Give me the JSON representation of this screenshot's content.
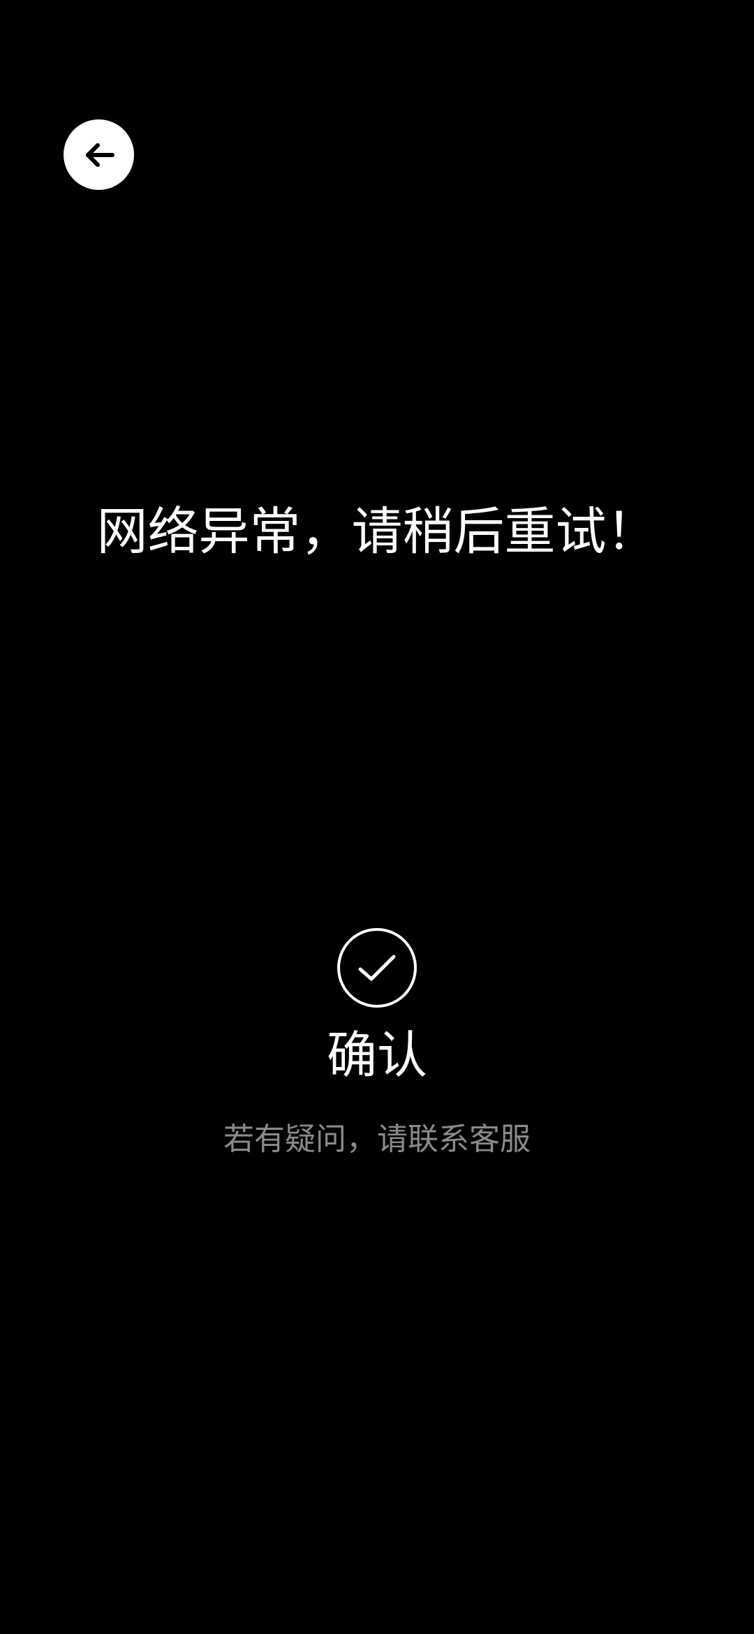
{
  "screen": {
    "background": "#000000"
  },
  "back_button": {
    "icon": "arrow-left-icon",
    "color": "#ffffff"
  },
  "message": {
    "text": "网络异常，请稍后重试！"
  },
  "confirm": {
    "icon": "check-circle-icon",
    "label": "确认"
  },
  "help": {
    "text": "若有疑问，请联系客服"
  }
}
